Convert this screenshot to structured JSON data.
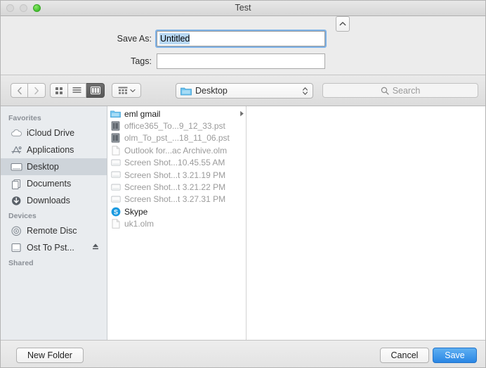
{
  "window": {
    "title": "Test",
    "traffic_lights": [
      {
        "name": "close",
        "state": "disabled"
      },
      {
        "name": "minimize",
        "state": "disabled"
      },
      {
        "name": "zoom",
        "state": "enabled",
        "color": "#4cc735"
      }
    ]
  },
  "name_panel": {
    "save_as_label": "Save As:",
    "save_as_value": "Untitled",
    "tags_label": "Tags:",
    "tags_value": "",
    "tags_placeholder": "",
    "collapse_icon": "chevron-up-icon"
  },
  "toolbar": {
    "back_icon": "chevron-left-icon",
    "forward_icon": "chevron-right-icon",
    "view_modes": [
      {
        "name": "icon-view",
        "icon": "grid-icon",
        "selected": false
      },
      {
        "name": "list-view",
        "icon": "list-icon",
        "selected": false
      },
      {
        "name": "column-view",
        "icon": "columns-icon",
        "selected": true
      }
    ],
    "arrange_icon": "arrange-icon",
    "arrange_chevron": "chevron-down-icon",
    "path_popup": {
      "label": "Desktop",
      "icon": "folder-icon",
      "stepper_icon": "up-down-chevron-icon"
    },
    "search": {
      "placeholder": "Search",
      "value": "",
      "icon": "search-icon"
    }
  },
  "sidebar": {
    "sections": [
      {
        "title": "Favorites",
        "items": [
          {
            "label": "iCloud Drive",
            "icon": "cloud-icon",
            "selected": false
          },
          {
            "label": "Applications",
            "icon": "applications-icon",
            "selected": false
          },
          {
            "label": "Desktop",
            "icon": "desktop-icon",
            "selected": true
          },
          {
            "label": "Documents",
            "icon": "documents-icon",
            "selected": false
          },
          {
            "label": "Downloads",
            "icon": "downloads-icon",
            "selected": false
          }
        ]
      },
      {
        "title": "Devices",
        "items": [
          {
            "label": "Remote Disc",
            "icon": "disc-icon",
            "selected": false
          },
          {
            "label": "Ost To Pst...",
            "icon": "drive-icon",
            "selected": false,
            "eject": true
          }
        ]
      },
      {
        "title": "Shared",
        "items": []
      }
    ]
  },
  "file_list": [
    {
      "name": "eml gmail",
      "icon": "folder-icon",
      "style": "folder",
      "disclosure": true
    },
    {
      "name": "office365_To...9_12_33.pst",
      "icon": "pst-icon",
      "style": "dim",
      "disclosure": false
    },
    {
      "name": "olm_To_pst_...18_11_06.pst",
      "icon": "pst-icon",
      "style": "dim",
      "disclosure": false
    },
    {
      "name": "Outlook for...ac Archive.olm",
      "icon": "document-icon",
      "style": "dim",
      "disclosure": false
    },
    {
      "name": "Screen Shot...10.45.55 AM",
      "icon": "screenshot-icon",
      "style": "dim",
      "disclosure": false
    },
    {
      "name": "Screen Shot...t 3.21.19 PM",
      "icon": "screenshot-icon",
      "style": "dim",
      "disclosure": false
    },
    {
      "name": "Screen Shot...t 3.21.22 PM",
      "icon": "screenshot-icon",
      "style": "dim",
      "disclosure": false
    },
    {
      "name": "Screen Shot...t 3.27.31 PM",
      "icon": "screenshot-icon",
      "style": "dim",
      "disclosure": false
    },
    {
      "name": "Skype",
      "icon": "skype-icon",
      "style": "enabled",
      "disclosure": false
    },
    {
      "name": "uk1.olm",
      "icon": "document-icon",
      "style": "dim",
      "disclosure": false
    }
  ],
  "bottom_bar": {
    "new_folder_label": "New Folder",
    "cancel_label": "Cancel",
    "save_label": "Save",
    "save_accent_color": "#2a86e4"
  }
}
